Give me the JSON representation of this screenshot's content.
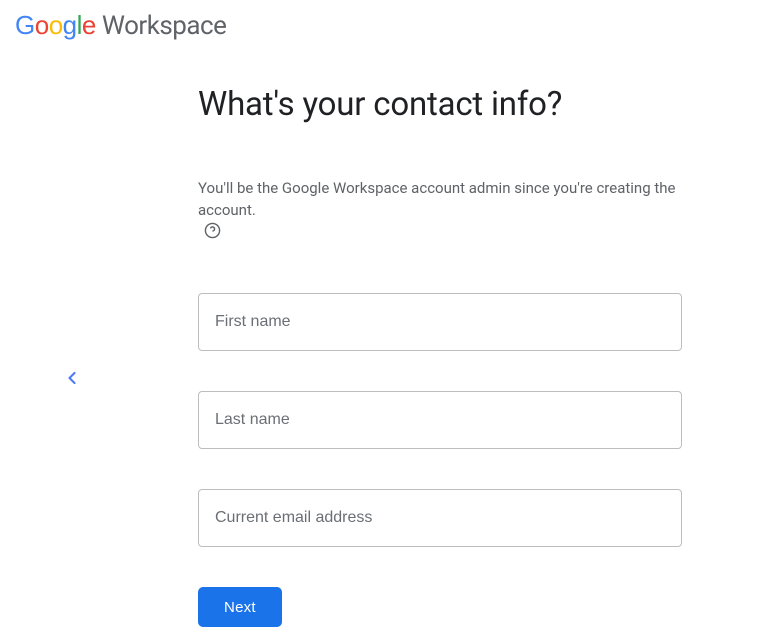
{
  "logo": {
    "brand": "Google",
    "product": "Workspace"
  },
  "form": {
    "heading": "What's your contact info?",
    "subtext": "You'll be the Google Workspace account admin since you're creating the account.",
    "fields": {
      "first_name_placeholder": "First name",
      "last_name_placeholder": "Last name",
      "email_placeholder": "Current email address",
      "first_name_value": "",
      "last_name_value": "",
      "email_value": ""
    },
    "next_button": "Next"
  }
}
